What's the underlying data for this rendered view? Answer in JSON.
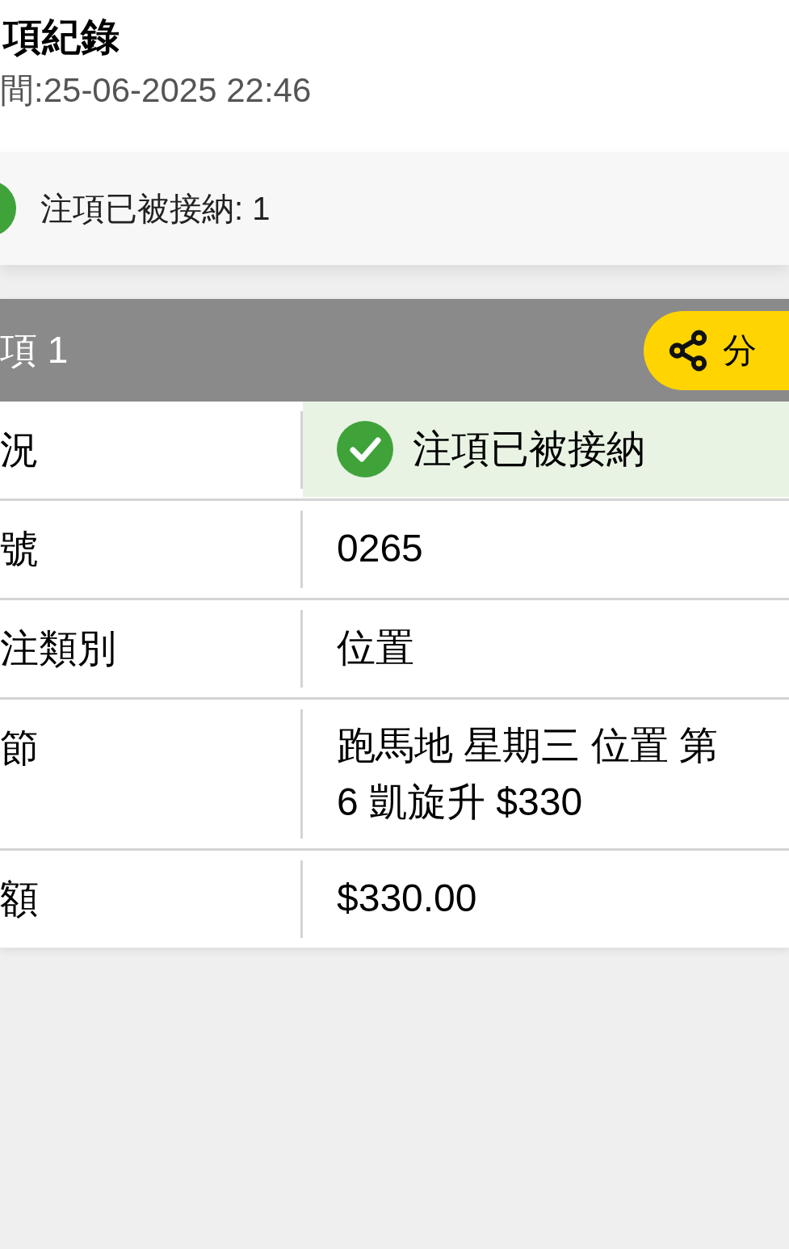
{
  "header": {
    "title": "項紀錄",
    "time": "間:25-06-2025 22:46"
  },
  "summary": {
    "text": "注項已被接納: 1"
  },
  "bet": {
    "title": "項 1",
    "share_label": "分",
    "rows": [
      {
        "kind": "status",
        "label": "況",
        "value": "注項已被接納",
        "accepted": true
      },
      {
        "kind": "text",
        "label": "號",
        "value": "0265"
      },
      {
        "kind": "text",
        "label": "注類別",
        "value": "位置"
      },
      {
        "kind": "lines",
        "label": "節",
        "lines": [
          "跑馬地 星期三 位置 第",
          "6 凱旋升 $330"
        ]
      },
      {
        "kind": "text",
        "label": "額",
        "value": "$330.00"
      }
    ]
  }
}
